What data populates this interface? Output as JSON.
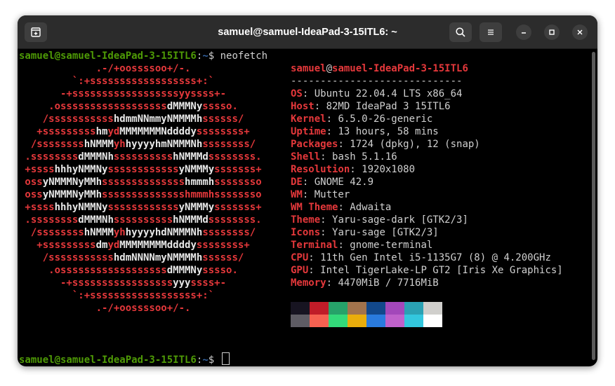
{
  "window": {
    "title": "samuel@samuel-IdeaPad-3-15ITL6: ~"
  },
  "prompt": {
    "user_host": "samuel@samuel-IdeaPad-3-15ITL6",
    "sep": ":",
    "path": "~",
    "symbol": "$",
    "command": "neofetch"
  },
  "ascii_art": [
    [
      {
        "t": "             .-/+oossssoo+/-.",
        "c": "red"
      }
    ],
    [
      {
        "t": "         `:+ssssssssssssssssss+:`",
        "c": "red"
      }
    ],
    [
      {
        "t": "       -+ssssssssssssssssssyyssss+-",
        "c": "red"
      }
    ],
    [
      {
        "t": "     .ossssssssssssssssss",
        "c": "red"
      },
      {
        "t": "dMMMNy",
        "c": "white"
      },
      {
        "t": "sssso.",
        "c": "red"
      }
    ],
    [
      {
        "t": "    /sssssssssss",
        "c": "red"
      },
      {
        "t": "hdmmNNmmyNMMMMh",
        "c": "white"
      },
      {
        "t": "ssssss/",
        "c": "red"
      }
    ],
    [
      {
        "t": "   +sssssssss",
        "c": "red"
      },
      {
        "t": "hm",
        "c": "white"
      },
      {
        "t": "yd",
        "c": "red"
      },
      {
        "t": "MMMMMMMNddddy",
        "c": "white"
      },
      {
        "t": "ssssssss+",
        "c": "red"
      }
    ],
    [
      {
        "t": "  /ssssssss",
        "c": "red"
      },
      {
        "t": "hNMMM",
        "c": "white"
      },
      {
        "t": "yh",
        "c": "red"
      },
      {
        "t": "hyyyyhmNMMMNh",
        "c": "white"
      },
      {
        "t": "ssssssss/",
        "c": "red"
      }
    ],
    [
      {
        "t": " .ssssssss",
        "c": "red"
      },
      {
        "t": "dMMMNh",
        "c": "white"
      },
      {
        "t": "ssssssssss",
        "c": "red"
      },
      {
        "t": "hNMMMd",
        "c": "white"
      },
      {
        "t": "ssssssss.",
        "c": "red"
      }
    ],
    [
      {
        "t": " +ssss",
        "c": "red"
      },
      {
        "t": "hhhyNMMNy",
        "c": "white"
      },
      {
        "t": "ssssssssssss",
        "c": "red"
      },
      {
        "t": "yNMMMy",
        "c": "white"
      },
      {
        "t": "sssssss+",
        "c": "red"
      }
    ],
    [
      {
        "t": " oss",
        "c": "red"
      },
      {
        "t": "yNMMMNyMMh",
        "c": "white"
      },
      {
        "t": "ssssssssssssss",
        "c": "red"
      },
      {
        "t": "hmmmh",
        "c": "white"
      },
      {
        "t": "ssssssso",
        "c": "red"
      }
    ],
    [
      {
        "t": " oss",
        "c": "red"
      },
      {
        "t": "yNMMMNyMMh",
        "c": "white"
      },
      {
        "t": "sssssssssssssshmmmhssssssso",
        "c": "red"
      }
    ],
    [
      {
        "t": " +ssss",
        "c": "red"
      },
      {
        "t": "hhhyNMMNy",
        "c": "white"
      },
      {
        "t": "ssssssssssss",
        "c": "red"
      },
      {
        "t": "yNMMMy",
        "c": "white"
      },
      {
        "t": "sssssss+",
        "c": "red"
      }
    ],
    [
      {
        "t": " .ssssssss",
        "c": "red"
      },
      {
        "t": "dMMMNh",
        "c": "white"
      },
      {
        "t": "ssssssssss",
        "c": "red"
      },
      {
        "t": "hNMMMd",
        "c": "white"
      },
      {
        "t": "ssssssss.",
        "c": "red"
      }
    ],
    [
      {
        "t": "  /ssssssss",
        "c": "red"
      },
      {
        "t": "hNMMM",
        "c": "white"
      },
      {
        "t": "yh",
        "c": "red"
      },
      {
        "t": "hyyyyhdNMMMNh",
        "c": "white"
      },
      {
        "t": "ssssssss/",
        "c": "red"
      }
    ],
    [
      {
        "t": "   +sssssssss",
        "c": "red"
      },
      {
        "t": "dm",
        "c": "white"
      },
      {
        "t": "yd",
        "c": "red"
      },
      {
        "t": "MMMMMMMMddddy",
        "c": "white"
      },
      {
        "t": "ssssssss+",
        "c": "red"
      }
    ],
    [
      {
        "t": "    /sssssssssss",
        "c": "red"
      },
      {
        "t": "hdmNNNNmyNMMMMh",
        "c": "white"
      },
      {
        "t": "ssssss/",
        "c": "red"
      }
    ],
    [
      {
        "t": "     .ossssssssssssssssss",
        "c": "red"
      },
      {
        "t": "dMMMNy",
        "c": "white"
      },
      {
        "t": "sssso.",
        "c": "red"
      }
    ],
    [
      {
        "t": "       -+sssssssssssssssss",
        "c": "red"
      },
      {
        "t": "yyy",
        "c": "white"
      },
      {
        "t": "ssss+-",
        "c": "red"
      }
    ],
    [
      {
        "t": "         `:+ssssssssssssssssss+:`",
        "c": "red"
      }
    ],
    [
      {
        "t": "             .-/+oossssoo+/-.",
        "c": "red"
      }
    ]
  ],
  "info": {
    "user": "samuel",
    "at": "@",
    "host": "samuel-IdeaPad-3-15ITL6",
    "separator": "-----------------------------",
    "rows": [
      {
        "key": "OS",
        "value": "Ubuntu 22.04.4 LTS x86_64"
      },
      {
        "key": "Host",
        "value": "82MD IdeaPad 3 15ITL6"
      },
      {
        "key": "Kernel",
        "value": "6.5.0-26-generic"
      },
      {
        "key": "Uptime",
        "value": "13 hours, 58 mins"
      },
      {
        "key": "Packages",
        "value": "1724 (dpkg), 12 (snap)"
      },
      {
        "key": "Shell",
        "value": "bash 5.1.16"
      },
      {
        "key": "Resolution",
        "value": "1920x1080"
      },
      {
        "key": "DE",
        "value": "GNOME 42.9"
      },
      {
        "key": "WM",
        "value": "Mutter"
      },
      {
        "key": "WM Theme",
        "value": "Adwaita"
      },
      {
        "key": "Theme",
        "value": "Yaru-sage-dark [GTK2/3]"
      },
      {
        "key": "Icons",
        "value": "Yaru-sage [GTK2/3]"
      },
      {
        "key": "Terminal",
        "value": "gnome-terminal"
      },
      {
        "key": "CPU",
        "value": "11th Gen Intel i5-1135G7 (8) @ 4.200GHz"
      },
      {
        "key": "GPU",
        "value": "Intel TigerLake-LP GT2 [Iris Xe Graphics]"
      },
      {
        "key": "Memory",
        "value": "4470MiB / 7716MiB"
      }
    ],
    "palette_row1": [
      "#171421",
      "#c01c28",
      "#26a269",
      "#a2734c",
      "#12488b",
      "#a347ba",
      "#2aa1b3",
      "#d0cfcc"
    ],
    "palette_row2": [
      "#5e5c64",
      "#f66151",
      "#33da7a",
      "#e9ad0c",
      "#2a7bde",
      "#c061cb",
      "#33c7de",
      "#ffffff"
    ]
  },
  "colors": {
    "prompt_green": "#4e9a06",
    "prompt_blue": "#3465a4",
    "logo_red": "#e5383b",
    "titlebar": "#2c2c2c"
  },
  "icons": {
    "new_tab": "new-tab-icon",
    "search": "search-icon",
    "menu": "hamburger-menu-icon",
    "minimize": "minimize-icon",
    "maximize": "maximize-icon",
    "close": "close-icon"
  }
}
